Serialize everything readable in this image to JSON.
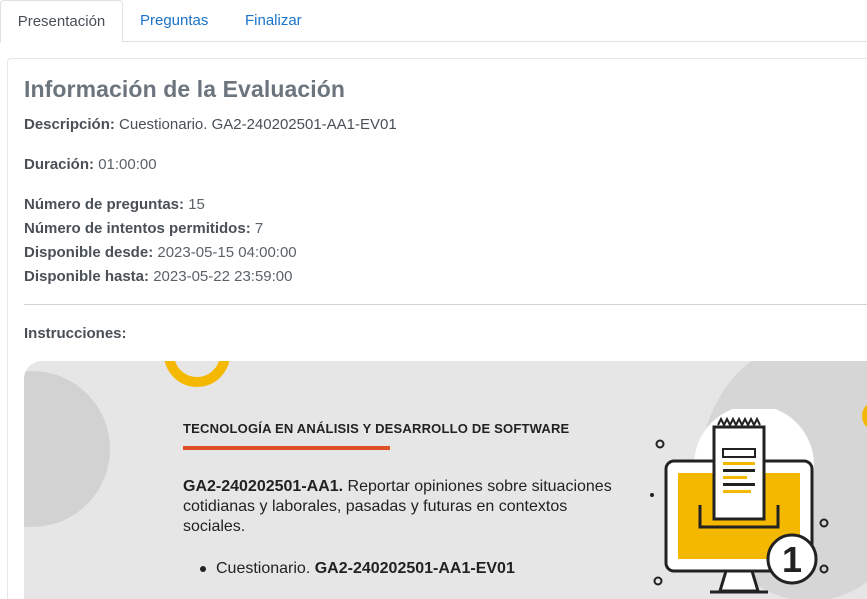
{
  "tabs": [
    {
      "label": "Presentación",
      "active": true
    },
    {
      "label": "Preguntas",
      "active": false
    },
    {
      "label": "Finalizar",
      "active": false
    }
  ],
  "evaluation": {
    "title": "Información de la Evaluación",
    "description_label": "Descripción:",
    "description_value": "Cuestionario. GA2-240202501-AA1-EV01",
    "duration_label": "Duración:",
    "duration_value": "01:00:00",
    "questions_label": "Número de preguntas:",
    "questions_value": "15",
    "attempts_label": "Número de intentos permitidos:",
    "attempts_value": "7",
    "from_label": "Disponible desde:",
    "from_value": "2023-05-15 04:00:00",
    "until_label": "Disponible hasta:",
    "until_value": "2023-05-22 23:59:00",
    "instructions_label": "Instrucciones:"
  },
  "banner": {
    "heading": "TECNOLOGÍA EN ANÁLISIS Y DESARROLLO DE SOFTWARE",
    "code_bold": "GA2-240202501-AA1.",
    "description": "Reportar opiniones sobre situaciones cotidianas y laborales, pasadas y futuras en contextos sociales.",
    "bullet_text": "Cuestionario.",
    "bullet_bold": "GA2-240202501-AA1-EV01",
    "illustration_number": "1",
    "illustration_icon": "computer-document-icon"
  },
  "colors": {
    "accent_yellow": "#f5b800",
    "heading_bar": "#e0512a",
    "link_blue": "#1a73c8"
  }
}
